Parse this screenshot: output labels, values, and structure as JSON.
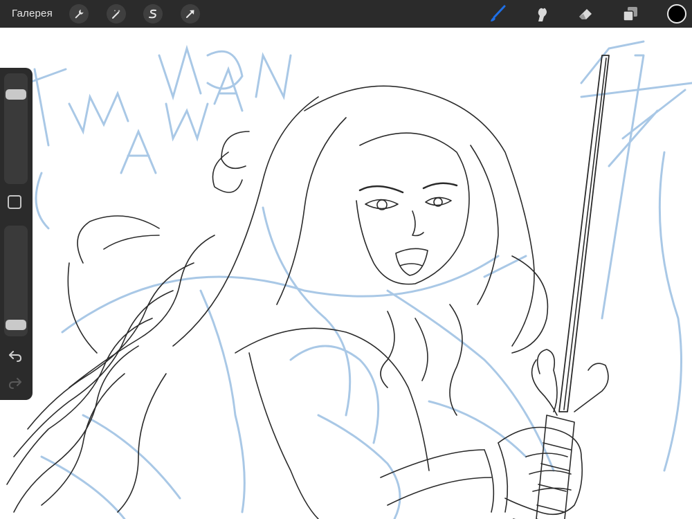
{
  "app": {
    "gallery_label": "Галерея"
  },
  "toolbar": {
    "left_tools": [
      {
        "icon": "wrench-icon",
        "name": "actions"
      },
      {
        "icon": "magic-wand-icon",
        "name": "adjustments"
      },
      {
        "icon": "selection-s-icon",
        "name": "selection"
      },
      {
        "icon": "transform-arrow-icon",
        "name": "transform"
      }
    ],
    "right_tools": [
      {
        "icon": "brush-icon",
        "name": "paint",
        "active": true
      },
      {
        "icon": "smudge-icon",
        "name": "smudge"
      },
      {
        "icon": "eraser-icon",
        "name": "erase"
      },
      {
        "icon": "layers-icon",
        "name": "layers"
      }
    ],
    "current_color": "#000000"
  },
  "sidebar": {
    "brush_size_level": 0.86,
    "opacity_level": 0.04,
    "tools": [
      "modify-button-icon",
      "undo-icon",
      "redo-icon"
    ]
  },
  "theme": {
    "bar_color": "#2b2b2b",
    "active_tool_color": "#1e6fe6",
    "sketch_blue": "#a9c8e6",
    "ink_color": "#2a2a2a"
  }
}
